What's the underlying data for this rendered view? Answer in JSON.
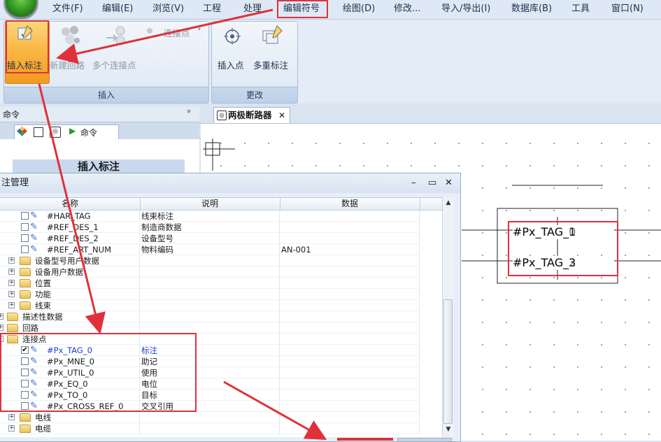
{
  "menu": {
    "items": [
      "文件(F)",
      "编辑(E)",
      "浏览(V)",
      "工程",
      "处理",
      "编辑符号",
      "绘图(D)",
      "修改...",
      "导入/导出(I)",
      "数据库(B)",
      "工具",
      "窗口(N)"
    ]
  },
  "ribbon": {
    "insert_group": {
      "title": "插入",
      "insert_annotation": "插入标注",
      "new_loop": "新建回路",
      "multi_connection": "多个连接点",
      "connection_point": "连接点"
    },
    "modify_group": {
      "title": "更改",
      "insert_point": "插入点",
      "multi_annotation": "多重标注"
    }
  },
  "command_panel": {
    "title": "命令",
    "pin": "ᵖ",
    "tab_label": "命令",
    "heading": "插入标注"
  },
  "document": {
    "tab_title": "两极断路器",
    "close": "✕",
    "symbol_text": {
      "line1": "#Px_TAG_1",
      "line2": "#Px_TAG_3",
      "overlay1": "#Px_TAG_0",
      "overlay2": "#Px_TAG_2"
    }
  },
  "manager": {
    "title": "注管理",
    "controls": {
      "minimize": "–",
      "restore": "▭",
      "close": "✕"
    },
    "columns": [
      "名称",
      "说明",
      "数据"
    ],
    "rows": [
      {
        "kind": "item",
        "level": 2,
        "name": "#HAR_TAG",
        "desc": "线束标注",
        "data": "",
        "checked": false
      },
      {
        "kind": "item",
        "level": 2,
        "name": "#REF_DES_1",
        "desc": "制造商数据",
        "data": "",
        "checked": false
      },
      {
        "kind": "item",
        "level": 2,
        "name": "#REF_DES_2",
        "desc": "设备型号",
        "data": "",
        "checked": false
      },
      {
        "kind": "item",
        "level": 2,
        "name": "#REF_ART_NUM",
        "desc": "物料编码",
        "data": "AN-001",
        "checked": false
      },
      {
        "kind": "folder",
        "level": 1,
        "name": "设备型号用户数据",
        "expander": "+"
      },
      {
        "kind": "folder",
        "level": 1,
        "name": "设备用户数据",
        "expander": "+"
      },
      {
        "kind": "folder",
        "level": 1,
        "name": "位置",
        "expander": "+"
      },
      {
        "kind": "folder",
        "level": 1,
        "name": "功能",
        "expander": "+"
      },
      {
        "kind": "folder",
        "level": 1,
        "name": "线束",
        "expander": "+"
      },
      {
        "kind": "folder",
        "level": 0,
        "name": "描述性数据",
        "expander": "+"
      },
      {
        "kind": "folder",
        "level": 0,
        "name": "回路",
        "expander": "+"
      },
      {
        "kind": "folder",
        "level": 0,
        "name": "连接点",
        "expander": "–"
      },
      {
        "kind": "item",
        "level": 1,
        "name": "#Px_TAG_0",
        "desc": "标注",
        "data": "",
        "checked": true,
        "highlight": true
      },
      {
        "kind": "item",
        "level": 1,
        "name": "#Px_MNE_0",
        "desc": "助记",
        "data": "",
        "checked": false
      },
      {
        "kind": "item",
        "level": 1,
        "name": "#Px_UTIL_0",
        "desc": "使用",
        "data": "",
        "checked": false
      },
      {
        "kind": "item",
        "level": 1,
        "name": "#Px_EQ_0",
        "desc": "电位",
        "data": "",
        "checked": false
      },
      {
        "kind": "item",
        "level": 1,
        "name": "#Px_TO_0",
        "desc": "目标",
        "data": "",
        "checked": false
      },
      {
        "kind": "item",
        "level": 1,
        "name": "#Px_CROSS_REF_0",
        "desc": "交叉引用",
        "data": "",
        "checked": false
      },
      {
        "kind": "folder",
        "level": 1,
        "name": "电线",
        "expander": "+"
      },
      {
        "kind": "folder",
        "level": 1,
        "name": "电缆",
        "expander": "+"
      }
    ]
  },
  "colors": {
    "highlight_red": "#e0313a",
    "selected_blue": "#1d3fd6",
    "ribbon_active": "#f9b844"
  },
  "icons": [
    "app-orb-icon",
    "pencil-annotation-icon",
    "molecule-icon",
    "connection-icon",
    "target-icon",
    "multi-annotation-icon",
    "folder-icon",
    "checkbox-icon"
  ]
}
